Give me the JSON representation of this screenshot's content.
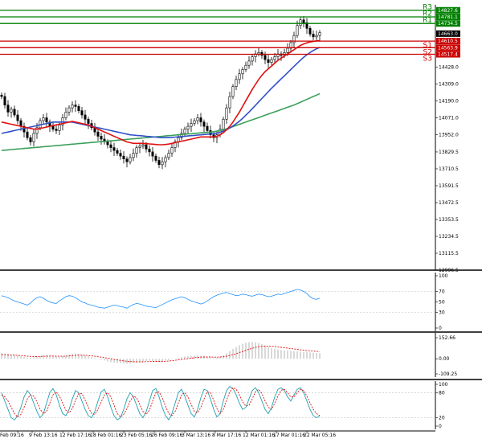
{
  "chart_data": {
    "type": "line",
    "price_axis_ticks": [
      "14428.0",
      "14309.0",
      "14190.0",
      "14071.0",
      "13952.0",
      "13829.5",
      "13710.5",
      "13591.5",
      "13472.5",
      "13353.5",
      "13234.5",
      "13115.5",
      "12996.5"
    ],
    "price_ylim": [
      12996.5,
      14866
    ],
    "time_labels": [
      "Feb 09:16",
      "9 Feb 13:16",
      "12 Feb 17:16",
      "18 Feb 01:16",
      "23 Feb 05:16",
      "26 Feb 09:16",
      "3 Mar 13:16",
      "8 Mar 17:16",
      "12 Mar 01:16",
      "17 Mar 01:16",
      "22 Mar 05:16"
    ],
    "levels": [
      {
        "name": "R3",
        "value": 14827.6,
        "tag": "14827.6",
        "color": "#008000"
      },
      {
        "name": "R2",
        "value": 14781.1,
        "tag": "14781.1",
        "color": "#008000"
      },
      {
        "name": "R1",
        "value": 14734.5,
        "tag": "14734.5",
        "color": "#008000"
      },
      {
        "name": "S1",
        "value": 14610.5,
        "tag": "14610.5",
        "color": "#cc0000"
      },
      {
        "name": "S2",
        "value": 14563.9,
        "tag": "14563.9",
        "color": "#cc0000"
      },
      {
        "name": "S3",
        "value": 14517.4,
        "tag": "14517.4",
        "color": "#cc0000"
      }
    ],
    "current_price": {
      "value": 14663.0,
      "tag": "14663.0"
    },
    "close_series": [
      14220,
      14160,
      14110,
      14130,
      14090,
      14050,
      14010,
      13970,
      13930,
      13900,
      13960,
      14000,
      14050,
      14070,
      14040,
      14010,
      13990,
      13980,
      14020,
      14070,
      14110,
      14140,
      14160,
      14150,
      14120,
      14090,
      14060,
      14030,
      14000,
      13970,
      13940,
      13920,
      13900,
      13880,
      13860,
      13840,
      13820,
      13800,
      13780,
      13760,
      13790,
      13820,
      13860,
      13870,
      13880,
      13850,
      13830,
      13800,
      13770,
      13740,
      13760,
      13790,
      13820,
      13860,
      13900,
      13930,
      13960,
      13990,
      14010,
      14030,
      14050,
      14070,
      14040,
      14010,
      13980,
      13950,
      13930,
      13950,
      13990,
      14060,
      14140,
      14220,
      14290,
      14340,
      14380,
      14410,
      14440,
      14470,
      14500,
      14520,
      14530,
      14510,
      14480,
      14460,
      14480,
      14500,
      14520,
      14510,
      14530,
      14560,
      14600,
      14650,
      14720,
      14760,
      14740,
      14700,
      14660,
      14640,
      14650,
      14670
    ],
    "ma_fast": [
      14040,
      14035,
      14030,
      14025,
      14020,
      14015,
      14010,
      14005,
      14000,
      13995,
      13990,
      13990,
      13995,
      14000,
      14005,
      14010,
      14015,
      14020,
      14025,
      14030,
      14035,
      14040,
      14045,
      14040,
      14035,
      14030,
      14025,
      14020,
      14010,
      14000,
      13990,
      13980,
      13970,
      13960,
      13950,
      13940,
      13930,
      13920,
      13910,
      13900,
      13895,
      13890,
      13890,
      13890,
      13890,
      13888,
      13886,
      13884,
      13882,
      13880,
      13880,
      13882,
      13885,
      13890,
      13895,
      13900,
      13905,
      13910,
      13915,
      13920,
      13925,
      13930,
      13935,
      13935,
      13935,
      13935,
      13935,
      13940,
      13950,
      13965,
      13985,
      14010,
      14040,
      14075,
      14110,
      14150,
      14190,
      14230,
      14270,
      14305,
      14340,
      14370,
      14395,
      14415,
      14435,
      14455,
      14475,
      14490,
      14505,
      14520,
      14535,
      14550,
      14565,
      14580,
      14590,
      14598,
      14604,
      14608,
      14612,
      14614
    ],
    "ma_mid": [
      13960,
      13965,
      13970,
      13975,
      13980,
      13985,
      13990,
      13995,
      14000,
      14005,
      14010,
      14015,
      14020,
      14025,
      14030,
      14035,
      14040,
      14040,
      14040,
      14040,
      14040,
      14040,
      14040,
      14035,
      14030,
      14025,
      14020,
      14015,
      14010,
      14005,
      14000,
      13995,
      13990,
      13985,
      13980,
      13975,
      13970,
      13965,
      13960,
      13955,
      13950,
      13948,
      13946,
      13944,
      13942,
      13940,
      13938,
      13936,
      13934,
      13932,
      13930,
      13930,
      13930,
      13932,
      13934,
      13936,
      13938,
      13940,
      13942,
      13944,
      13946,
      13948,
      13950,
      13952,
      13954,
      13956,
      13958,
      13962,
      13968,
      13976,
      13986,
      13998,
      14012,
      14028,
      14046,
      14066,
      14088,
      14110,
      14134,
      14158,
      14182,
      14206,
      14230,
      14254,
      14278,
      14300,
      14322,
      14344,
      14366,
      14388,
      14410,
      14432,
      14454,
      14476,
      14496,
      14514,
      14530,
      14544,
      14556,
      14566
    ],
    "ma_slow": [
      13840,
      13842,
      13844,
      13846,
      13848,
      13850,
      13852,
      13854,
      13856,
      13858,
      13860,
      13862,
      13864,
      13866,
      13868,
      13870,
      13872,
      13874,
      13876,
      13878,
      13880,
      13882,
      13884,
      13886,
      13888,
      13890,
      13892,
      13894,
      13896,
      13898,
      13900,
      13902,
      13904,
      13906,
      13908,
      13910,
      13912,
      13914,
      13916,
      13918,
      13920,
      13922,
      13924,
      13926,
      13928,
      13930,
      13932,
      13934,
      13936,
      13938,
      13940,
      13942,
      13944,
      13946,
      13948,
      13950,
      13952,
      13954,
      13956,
      13958,
      13960,
      13962,
      13964,
      13966,
      13968,
      13970,
      13972,
      13976,
      13980,
      13986,
      13992,
      14000,
      14008,
      14016,
      14024,
      14032,
      14040,
      14048,
      14056,
      14064,
      14072,
      14080,
      14088,
      14096,
      14104,
      14112,
      14120,
      14128,
      14136,
      14144,
      14152,
      14160,
      14170,
      14180,
      14190,
      14200,
      14210,
      14220,
      14230,
      14240
    ],
    "rsi": {
      "ticks": [
        "100",
        "70",
        "50",
        "30",
        "0"
      ],
      "ylim": [
        0,
        100
      ],
      "values": [
        62,
        60,
        58,
        55,
        52,
        50,
        48,
        46,
        44,
        48,
        54,
        58,
        60,
        57,
        53,
        50,
        48,
        47,
        52,
        56,
        60,
        62,
        61,
        58,
        54,
        50,
        48,
        45,
        44,
        42,
        40,
        39,
        38,
        40,
        42,
        44,
        43,
        41,
        40,
        38,
        42,
        45,
        47,
        46,
        44,
        42,
        41,
        40,
        39,
        42,
        45,
        48,
        51,
        54,
        56,
        58,
        60,
        58,
        55,
        52,
        50,
        48,
        46,
        48,
        52,
        56,
        60,
        63,
        65,
        67,
        68,
        66,
        64,
        62,
        63,
        65,
        64,
        62,
        61,
        63,
        65,
        64,
        62,
        60,
        61,
        63,
        65,
        64,
        66,
        68,
        70,
        72,
        74,
        73,
        70,
        66,
        60,
        56,
        55,
        57
      ]
    },
    "macd": {
      "ticks": [
        "152.66",
        "0.00",
        "-109.25"
      ],
      "ylim": [
        -109.25,
        152.66
      ],
      "values": [
        40,
        38,
        34,
        30,
        26,
        22,
        18,
        14,
        10,
        8,
        10,
        14,
        20,
        24,
        26,
        24,
        20,
        16,
        14,
        18,
        24,
        30,
        36,
        38,
        36,
        30,
        24,
        18,
        12,
        6,
        0,
        -6,
        -12,
        -18,
        -24,
        -28,
        -30,
        -32,
        -34,
        -36,
        -34,
        -30,
        -26,
        -22,
        -18,
        -16,
        -14,
        -16,
        -18,
        -20,
        -18,
        -14,
        -10,
        -4,
        2,
        8,
        12,
        16,
        18,
        20,
        22,
        24,
        22,
        18,
        14,
        10,
        8,
        10,
        16,
        26,
        40,
        56,
        72,
        86,
        98,
        108,
        116,
        120,
        122,
        120,
        114,
        106,
        96,
        86,
        78,
        72,
        68,
        64,
        62,
        60,
        58,
        56,
        54,
        52,
        50,
        48,
        46,
        44,
        42,
        40
      ],
      "signal": [
        30,
        30,
        29,
        28,
        27,
        25,
        23,
        21,
        19,
        17,
        16,
        16,
        17,
        18,
        19,
        20,
        20,
        19,
        18,
        18,
        19,
        21,
        23,
        25,
        26,
        26,
        25,
        23,
        21,
        18,
        15,
        12,
        8,
        4,
        0,
        -4,
        -8,
        -12,
        -15,
        -18,
        -20,
        -21,
        -22,
        -22,
        -22,
        -21,
        -20,
        -19,
        -19,
        -19,
        -19,
        -18,
        -16,
        -14,
        -11,
        -8,
        -5,
        -2,
        1,
        4,
        7,
        10,
        12,
        13,
        13,
        13,
        12,
        12,
        13,
        15,
        19,
        24,
        30,
        37,
        45,
        53,
        61,
        69,
        76,
        82,
        87,
        90,
        92,
        92,
        91,
        89,
        86,
        83,
        80,
        77,
        74,
        71,
        68,
        65,
        62,
        60,
        58,
        56,
        54,
        52
      ]
    },
    "stochastic": {
      "ticks": [
        "100",
        "80",
        "20",
        "0"
      ],
      "ylim": [
        0,
        100
      ],
      "k": [
        80,
        60,
        40,
        20,
        15,
        25,
        45,
        70,
        85,
        75,
        55,
        35,
        20,
        30,
        55,
        80,
        90,
        75,
        50,
        30,
        25,
        40,
        65,
        85,
        80,
        60,
        40,
        25,
        20,
        35,
        60,
        82,
        88,
        70,
        45,
        25,
        15,
        20,
        40,
        65,
        80,
        70,
        50,
        30,
        20,
        35,
        60,
        85,
        90,
        70,
        45,
        25,
        15,
        30,
        55,
        80,
        88,
        72,
        50,
        30,
        22,
        40,
        68,
        88,
        85,
        65,
        40,
        22,
        30,
        60,
        85,
        95,
        90,
        75,
        55,
        40,
        45,
        65,
        85,
        92,
        80,
        60,
        40,
        30,
        45,
        70,
        88,
        92,
        85,
        70,
        60,
        75,
        88,
        92,
        80,
        60,
        40,
        25,
        20,
        25
      ],
      "d": [
        75,
        70,
        60,
        45,
        30,
        22,
        28,
        45,
        65,
        75,
        72,
        58,
        40,
        30,
        35,
        55,
        75,
        82,
        72,
        55,
        38,
        32,
        42,
        62,
        78,
        78,
        62,
        45,
        30,
        28,
        40,
        58,
        75,
        80,
        70,
        50,
        30,
        22,
        28,
        42,
        60,
        72,
        68,
        52,
        35,
        28,
        38,
        60,
        80,
        82,
        68,
        48,
        30,
        25,
        35,
        55,
        75,
        80,
        70,
        52,
        35,
        32,
        45,
        65,
        82,
        80,
        62,
        42,
        30,
        40,
        62,
        82,
        92,
        88,
        75,
        58,
        48,
        50,
        65,
        82,
        88,
        78,
        60,
        45,
        40,
        55,
        72,
        86,
        88,
        80,
        70,
        70,
        80,
        88,
        85,
        72,
        55,
        40,
        30,
        25
      ]
    }
  }
}
